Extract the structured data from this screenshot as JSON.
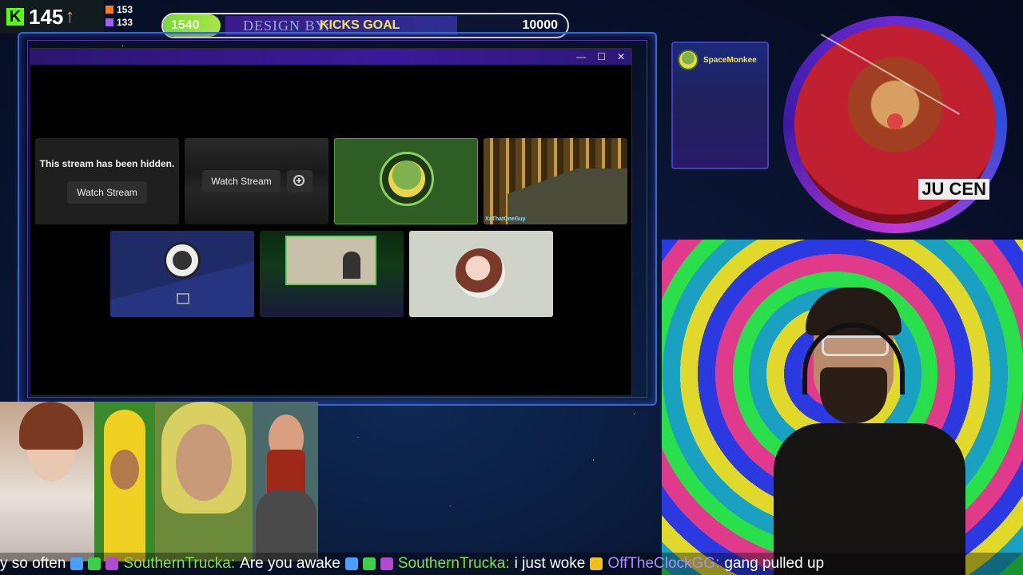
{
  "hud": {
    "kick_count": "145",
    "stat_top": "153",
    "stat_bottom": "133",
    "goal": {
      "current": "1540",
      "design_credit": "DESIGN BY:",
      "label": "KICKS GOAL",
      "max": "10000",
      "progress_fraction": 0.154
    }
  },
  "window": {
    "controls": {
      "minimize": "—",
      "maximize": "☐",
      "close": "✕"
    },
    "tiles": {
      "hidden_message": "This stream has been hidden.",
      "watch_stream_1": "Watch Stream",
      "watch_stream_2": "Watch Stream",
      "game_label": "XxThatOneGuy"
    }
  },
  "side_panel": {
    "chat_user": "SpaceMonkee",
    "disc_text": "JU CEN"
  },
  "ticker": {
    "items": [
      {
        "user": "",
        "text": "y so often"
      },
      {
        "user": "SouthernTrucka:",
        "text": "Are you awake"
      },
      {
        "user": "SouthernTrucka:",
        "text": "i just woke"
      },
      {
        "user": "OffTheClockGG:",
        "text": "gang pulled up"
      }
    ]
  },
  "colors": {
    "kick_green": "#53fc18",
    "goal_fill": "#7bd93a",
    "goal_label": "#f4e54c",
    "frame_blue": "#3868c8",
    "title_purple": "#3a1a9a"
  }
}
